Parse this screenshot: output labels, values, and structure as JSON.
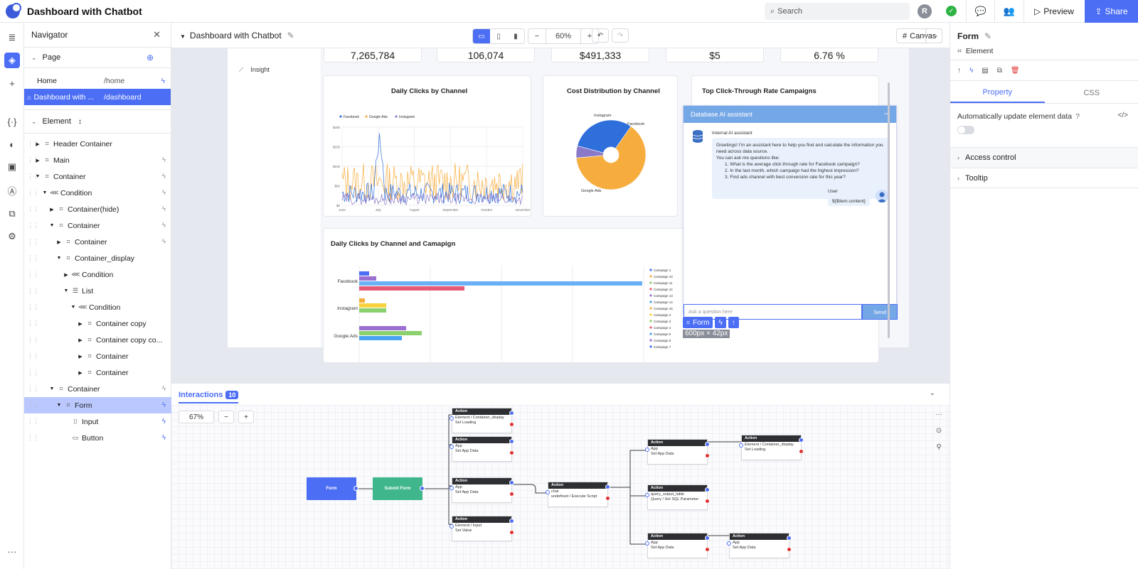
{
  "app": {
    "title": "Dashboard with Chatbot"
  },
  "topbar": {
    "search_placeholder": "Search",
    "avatar_letter": "R",
    "preview_label": "Preview",
    "share_label": "Share"
  },
  "navigator": {
    "title": "Navigator",
    "page_section": "Page",
    "pages": [
      {
        "name": "Home",
        "path": "/home"
      },
      {
        "name": "Dashboard with ...",
        "path": "/dashboard"
      }
    ],
    "element_section": "Element",
    "tree": [
      {
        "label": "Header Container",
        "level": 0
      },
      {
        "label": "Main",
        "level": 0
      },
      {
        "label": "Container",
        "level": 0
      },
      {
        "label": "Condition",
        "level": 1
      },
      {
        "label": "Container(hide)",
        "level": 2
      },
      {
        "label": "Container",
        "level": 2
      },
      {
        "label": "Container",
        "level": 3
      },
      {
        "label": "Container_display",
        "level": 3
      },
      {
        "label": "Condition",
        "level": 4
      },
      {
        "label": "List",
        "level": 4
      },
      {
        "label": "Condition",
        "level": 5
      },
      {
        "label": "Container copy",
        "level": 6
      },
      {
        "label": "Container copy co...",
        "level": 6
      },
      {
        "label": "Container",
        "level": 6
      },
      {
        "label": "Container",
        "level": 6
      },
      {
        "label": "Container",
        "level": 2
      },
      {
        "label": "Form",
        "level": 3
      },
      {
        "label": "Input",
        "level": 4
      },
      {
        "label": "Button",
        "level": 4
      }
    ]
  },
  "editor": {
    "breadcrumb": "Dashboard with Chatbot",
    "zoom": "60%",
    "canvas_label": "Canvas"
  },
  "dashboard": {
    "menu_item": "Insight",
    "kpis": [
      "7,265,784",
      "106,074",
      "$491,333",
      "$5",
      "6.76 %"
    ],
    "line_chart": {
      "title": "Daily Clicks by Channel",
      "legend": [
        "Facebook",
        "Google Ads",
        "Instagram"
      ],
      "yticks": [
        "$200",
        "$150",
        "$100",
        "$50",
        "$0"
      ],
      "xticks": [
        "June",
        "July",
        "August",
        "September",
        "October",
        "November"
      ]
    },
    "pie_chart": {
      "title": "Cost Distribution by Channel",
      "labels": [
        "Instagram",
        "Facebook",
        "Google Ads"
      ]
    },
    "rate_title": "Top Click-Through Rate Campaigns",
    "bar_chart": {
      "title": "Daily Clicks by Channel and Camapign",
      "categories": [
        "Facebook",
        "Instagram",
        "Google Ads"
      ],
      "legend": [
        "Campaign 1",
        "Campaign 10",
        "Campaign 11",
        "Campaign 12",
        "Campaign 13",
        "Campaign 14",
        "Campaign 15",
        "Campaign 2",
        "Campaign 3",
        "Campaign 4",
        "Campaign 5",
        "Campaign 6",
        "Campaign 7"
      ]
    }
  },
  "chat": {
    "header": "Database AI assistant",
    "bot_name": "Internal AI assistant",
    "greeting": "Greetings! I'm an assistant here to help you find and calculate the information you need across data source.",
    "examples_intro": "You can ask me questions like:",
    "examples": [
      "1. What is the average click through rate for Facebook campaign?",
      "2. In the last month, which campaign had the highest impression?",
      "3. Find ads channel with best conversion rate for this year?"
    ],
    "user_name": "User",
    "user_msg": "${$item.content}",
    "input_placeholder": "Ask a question here",
    "send_label": "Send"
  },
  "selection": {
    "tag": "Form",
    "size": "600px × 42px"
  },
  "inspector": {
    "title": "Form",
    "subtitle": "Element",
    "tabs": [
      "Property",
      "CSS"
    ],
    "auto_update_label": "Automatically update element data",
    "sections": [
      "Access control",
      "Tooltip"
    ]
  },
  "interactions": {
    "label": "Interactions",
    "count": "10",
    "zoom": "67%",
    "triggers": [
      {
        "label": "Form",
        "color": "#4c6ef5"
      },
      {
        "label": "Submit Form",
        "color": "#3fb68b"
      }
    ],
    "nodes": [
      {
        "title": "Action",
        "line1": "Element / Container_display",
        "line2": "Set Loading"
      },
      {
        "title": "Action",
        "line1": "App",
        "line2": "Set App Data"
      },
      {
        "title": "Action",
        "line1": "App",
        "line2": "Set App Data"
      },
      {
        "title": "Action",
        "line1": "Element / Input",
        "line2": "Set Value"
      },
      {
        "title": "Action",
        "line1": "chat",
        "line2": "undefined / Execute Script"
      },
      {
        "title": "Action",
        "line1": "App",
        "line2": "Set App Data"
      },
      {
        "title": "Action",
        "line1": "query_output_table",
        "line2": "Query / Set SQL Parameter"
      },
      {
        "title": "Action",
        "line1": "App",
        "line2": "Set App Data"
      },
      {
        "title": "Action",
        "line1": "Element / Container_display",
        "line2": "Set Loading"
      },
      {
        "title": "Action",
        "line1": "App",
        "line2": "Set App Data"
      }
    ]
  },
  "colors": {
    "accent": "#4c6ef5",
    "facebook": "#2f6fdb",
    "google": "#f7ad3e",
    "instagram": "#8a78c9"
  }
}
